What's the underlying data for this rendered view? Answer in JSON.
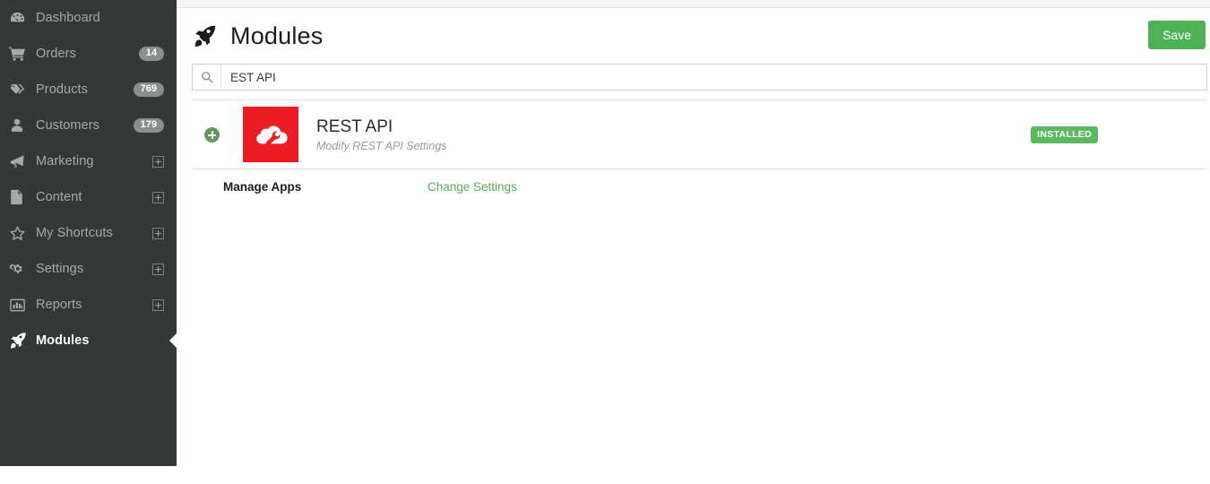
{
  "sidebar": {
    "items": [
      {
        "label": "Dashboard",
        "icon": "dashboard-icon",
        "badge": null,
        "expand": false,
        "active": false
      },
      {
        "label": "Orders",
        "icon": "cart-icon",
        "badge": "14",
        "expand": false,
        "active": false
      },
      {
        "label": "Products",
        "icon": "tag-icon",
        "badge": "769",
        "expand": false,
        "active": false
      },
      {
        "label": "Customers",
        "icon": "user-icon",
        "badge": "179",
        "expand": false,
        "active": false
      },
      {
        "label": "Marketing",
        "icon": "megaphone-icon",
        "badge": null,
        "expand": true,
        "active": false
      },
      {
        "label": "Content",
        "icon": "document-icon",
        "badge": null,
        "expand": true,
        "active": false
      },
      {
        "label": "My Shortcuts",
        "icon": "star-icon",
        "badge": null,
        "expand": true,
        "active": false
      },
      {
        "label": "Settings",
        "icon": "gears-icon",
        "badge": null,
        "expand": true,
        "active": false
      },
      {
        "label": "Reports",
        "icon": "bar-chart-icon",
        "badge": null,
        "expand": true,
        "active": false
      },
      {
        "label": "Modules",
        "icon": "rocket-icon",
        "badge": null,
        "expand": false,
        "active": true
      }
    ]
  },
  "header": {
    "title": "Modules",
    "icon": "rocket-icon",
    "save_label": "Save"
  },
  "search": {
    "value": "EST API",
    "placeholder": "",
    "icon": "search-icon"
  },
  "module": {
    "name": "REST API",
    "description": "Modify REST API Settings",
    "status_badge": "INSTALLED",
    "thumb_icon": "cloud-wrench-icon",
    "add_icon": "plus-circle-icon",
    "actions": {
      "manage_label": "Manage Apps",
      "settings_label": "Change Settings"
    }
  },
  "colors": {
    "sidebar_bg": "#333839",
    "accent_green": "#4cb255",
    "badge_green": "#5cb85c",
    "module_red": "#ed1c24",
    "link_green": "#5aa95e"
  }
}
